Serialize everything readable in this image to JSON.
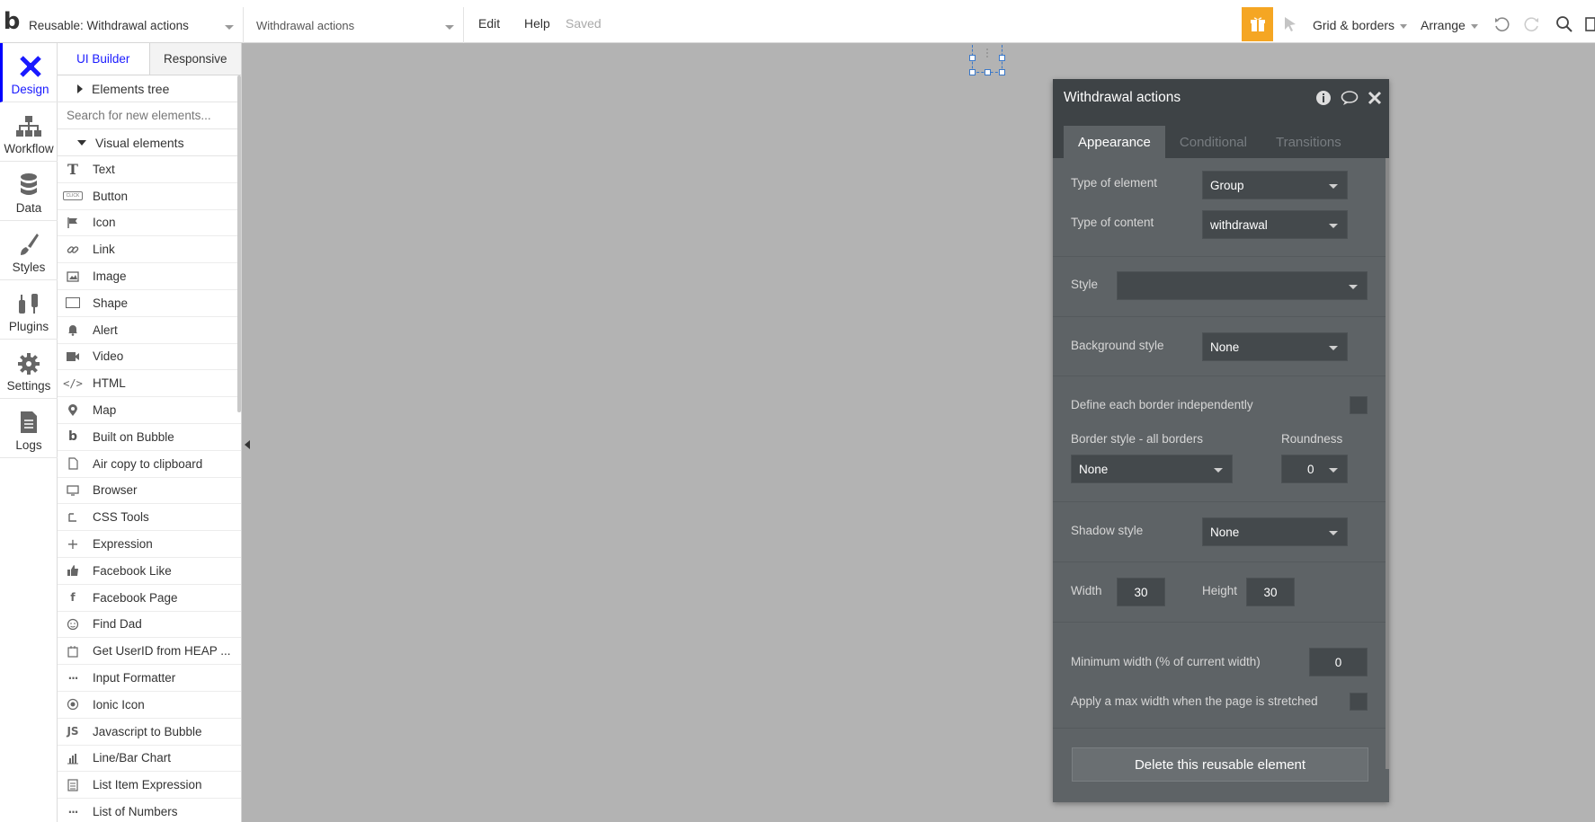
{
  "topbar": {
    "page_select": "Reusable: Withdrawal actions",
    "element_select": "Withdrawal actions",
    "menu_edit": "Edit",
    "menu_help": "Help",
    "status": "Saved",
    "grid": "Grid & borders",
    "arrange": "Arrange"
  },
  "leftnav": {
    "items": [
      {
        "label": "Design"
      },
      {
        "label": "Workflow"
      },
      {
        "label": "Data"
      },
      {
        "label": "Styles"
      },
      {
        "label": "Plugins"
      },
      {
        "label": "Settings"
      },
      {
        "label": "Logs"
      }
    ]
  },
  "palette": {
    "tab_builder": "UI Builder",
    "tab_responsive": "Responsive",
    "elements_tree": "Elements tree",
    "search_placeholder": "Search for new elements...",
    "visual_elements": "Visual elements",
    "items": [
      {
        "label": "Text",
        "icon": "text-icon"
      },
      {
        "label": "Button",
        "icon": "button-icon"
      },
      {
        "label": "Icon",
        "icon": "flag-icon"
      },
      {
        "label": "Link",
        "icon": "link-icon"
      },
      {
        "label": "Image",
        "icon": "image-icon"
      },
      {
        "label": "Shape",
        "icon": "shape-icon"
      },
      {
        "label": "Alert",
        "icon": "bell-icon"
      },
      {
        "label": "Video",
        "icon": "video-icon"
      },
      {
        "label": "HTML",
        "icon": "code-icon"
      },
      {
        "label": "Map",
        "icon": "pin-icon"
      },
      {
        "label": "Built on Bubble",
        "icon": "bubble-icon"
      },
      {
        "label": "Air copy to clipboard",
        "icon": "clipboard-icon"
      },
      {
        "label": "Browser",
        "icon": "monitor-icon"
      },
      {
        "label": "CSS Tools",
        "icon": "css-icon"
      },
      {
        "label": "Expression",
        "icon": "plus-icon"
      },
      {
        "label": "Facebook Like",
        "icon": "thumb-icon"
      },
      {
        "label": "Facebook Page",
        "icon": "facebook-icon"
      },
      {
        "label": "Find Dad",
        "icon": "smiley-icon"
      },
      {
        "label": "Get UserID from HEAP ...",
        "icon": "plugin-icon"
      },
      {
        "label": "Input Formatter",
        "icon": "dots-icon"
      },
      {
        "label": "Ionic Icon",
        "icon": "ionic-icon"
      },
      {
        "label": "Javascript to Bubble",
        "icon": "js-icon"
      },
      {
        "label": "Line/Bar Chart",
        "icon": "chart-icon"
      },
      {
        "label": "List Item Expression",
        "icon": "list-icon"
      },
      {
        "label": "List of Numbers",
        "icon": "dots-icon"
      }
    ]
  },
  "panel": {
    "title": "Withdrawal actions",
    "tabs": [
      "Appearance",
      "Conditional",
      "Transitions"
    ],
    "type_of_element_label": "Type of element",
    "type_of_element_value": "Group",
    "type_of_content_label": "Type of content",
    "type_of_content_value": "withdrawal",
    "style_label": "Style",
    "style_value": "",
    "background_label": "Background style",
    "background_value": "None",
    "define_border_label": "Define each border independently",
    "border_style_label": "Border style - all borders",
    "border_style_value": "None",
    "roundness_label": "Roundness",
    "roundness_value": "0",
    "shadow_label": "Shadow style",
    "shadow_value": "None",
    "width_label": "Width",
    "width_value": "30",
    "height_label": "Height",
    "height_value": "30",
    "min_width_label": "Minimum width (% of current width)",
    "min_width_value": "0",
    "max_width_label": "Apply a max width when the page is stretched",
    "delete_label": "Delete this reusable element"
  },
  "colors": {
    "accent": "#1a1aff",
    "gift": "#f5a623",
    "panel_bg": "#5e6366",
    "canvas": "#b3b3b3"
  }
}
